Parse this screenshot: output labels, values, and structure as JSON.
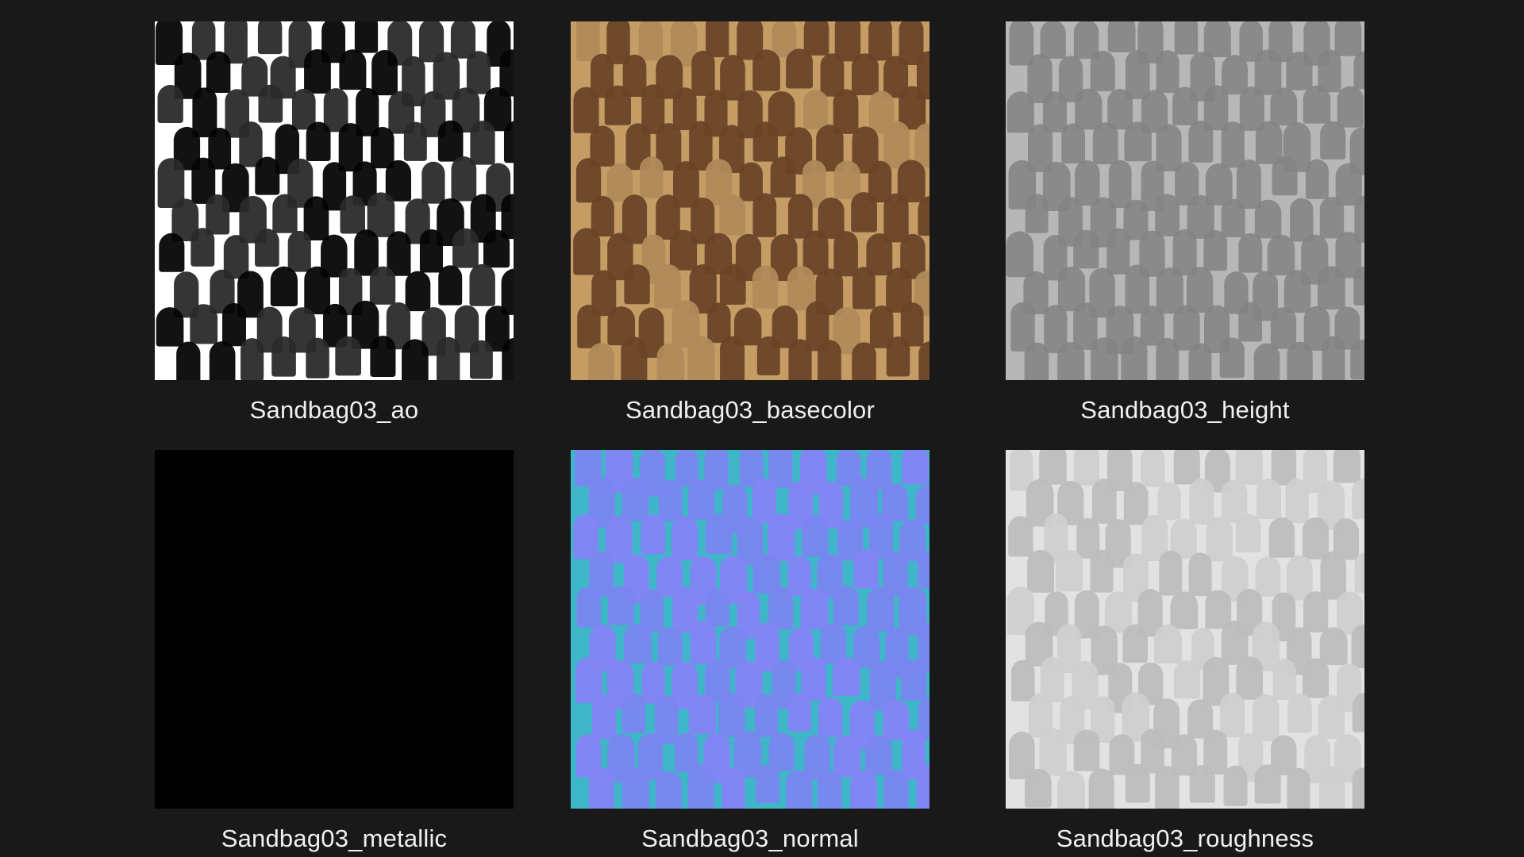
{
  "files": [
    {
      "name": "Sandbag03_ao",
      "icon": "ao-texture-thumbnail",
      "colors": {
        "bg": "#ffffff",
        "fg": "#050505"
      }
    },
    {
      "name": "Sandbag03_basecolor",
      "icon": "basecolor-texture-thumbnail",
      "colors": {
        "bg": "#c49c64",
        "fg": "#6a4428"
      }
    },
    {
      "name": "Sandbag03_height",
      "icon": "height-texture-thumbnail",
      "colors": {
        "bg": "#b7b7b7",
        "fg": "#828282"
      }
    },
    {
      "name": "Sandbag03_metallic",
      "icon": "metallic-texture-thumbnail",
      "colors": {
        "bg": "#000000",
        "fg": "#000000"
      }
    },
    {
      "name": "Sandbag03_normal",
      "icon": "normal-texture-thumbnail",
      "colors": {
        "bg": "#3fb6c8",
        "fg": "#8484f6"
      }
    },
    {
      "name": "Sandbag03_roughness",
      "icon": "roughness-texture-thumbnail",
      "colors": {
        "bg": "#e2e2e2",
        "fg": "#c8c8c8"
      }
    }
  ]
}
